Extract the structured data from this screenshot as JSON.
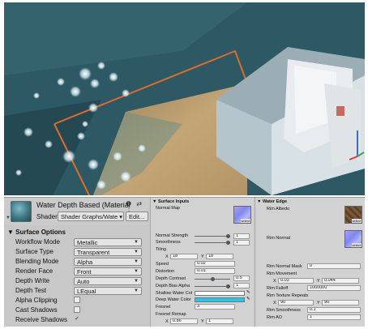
{
  "material": {
    "title": "Water Depth Based (Material",
    "shader_label": "Shader",
    "shader_value": "Shader Graphs/Wate ▾",
    "edit_label": "Edit...",
    "header_icons": "❷ ⇄ ⋮"
  },
  "surface_options": {
    "title": "Surface Options",
    "rows": [
      {
        "label": "Workflow Mode",
        "value": "Metallic"
      },
      {
        "label": "Surface Type",
        "value": "Transparent"
      },
      {
        "label": "Blending Mode",
        "value": "Alpha"
      },
      {
        "label": "Render Face",
        "value": "Front"
      },
      {
        "label": "Depth Write",
        "value": "Auto"
      },
      {
        "label": "Depth Test",
        "value": "LEqual"
      }
    ],
    "checks": [
      {
        "label": "Alpha Clipping",
        "checked": false
      },
      {
        "label": "Cast Shadows",
        "checked": false
      },
      {
        "label": "Receive Shadows",
        "checked": true
      }
    ]
  },
  "surface_inputs": {
    "title": "Surface Inputs",
    "normal_map": "Normal Map",
    "select": "select",
    "normal_strength": {
      "label": "Normal Strength",
      "value": "1",
      "fraction": 0.95
    },
    "smoothness": {
      "label": "Smoothness",
      "value": "1",
      "fraction": 0.95
    },
    "tiling": {
      "label": "Tiling",
      "x_label": "X",
      "x": "18",
      "y_label": "Y",
      "y": "18"
    },
    "speed": {
      "label": "Speed",
      "value": "0.02"
    },
    "distortion": {
      "label": "Distortion",
      "value": "0.01"
    },
    "depth_contrast": {
      "label": "Depth Contrast",
      "value": "0.5",
      "fraction": 0.5
    },
    "depth_bias_alpha": {
      "label": "Depth Bias Alpha",
      "value": "1",
      "fraction": 0.95
    },
    "shallow_color": {
      "label": "Shallow Water Col",
      "color": "#ffffff"
    },
    "deep_color": {
      "label": "Deep Water Color",
      "color": "#1ec8e6"
    },
    "fresnel": {
      "label": "Fresnel",
      "value": "3"
    },
    "fresnel_remap": {
      "label": "Fresnel Remap",
      "x_label": "X",
      "x": "0.86",
      "y_label": "Y",
      "y": "1"
    }
  },
  "water_edge": {
    "title": "Water Edge",
    "rim_albedo": "Rim Albedo",
    "rim_normal": "Rim Normal",
    "select": "select",
    "rim_normal_mask": {
      "label": "Rim Normal Mask",
      "value": "0"
    },
    "rim_movement": {
      "label": "Rim Movement",
      "x_label": "X",
      "x": "0.03",
      "y_label": "Y",
      "y": "0.044"
    },
    "rim_falloff": {
      "label": "Rim Falloff",
      "value": "1000000"
    },
    "rim_texture_repeats": {
      "label": "Rim Texture Repeats",
      "x_label": "X",
      "x": "90",
      "y_label": "Y",
      "y": "90"
    },
    "rim_smoothness": {
      "label": "Rim Smoothness",
      "value": "0.1"
    },
    "rim_ao": {
      "label": "Rim AO",
      "value": "1"
    }
  },
  "colors": {
    "selection_outline": "#e06a2a",
    "water": "#2d5a66",
    "sand": "#b89a6a"
  }
}
